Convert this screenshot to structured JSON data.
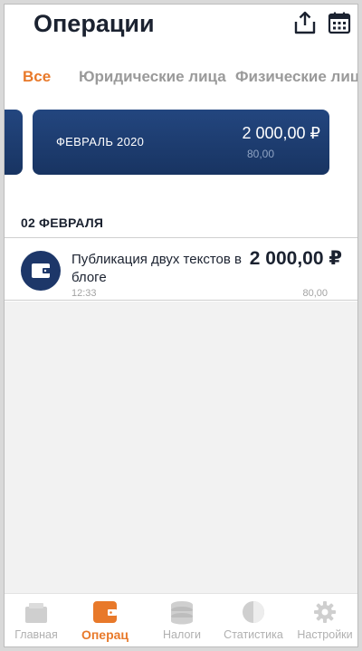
{
  "header": {
    "title": "Операции",
    "icons": [
      "share-icon",
      "calendar-icon"
    ]
  },
  "tabs": [
    {
      "label": "Все",
      "active": true
    },
    {
      "label": "Юридические лица",
      "active": false
    },
    {
      "label": "Физические лица",
      "active": false
    }
  ],
  "summary_card": {
    "month": "ФЕВРАЛЬ 2020",
    "amount": "2 000,00 ₽",
    "tax": "80,00"
  },
  "day_group": {
    "date": "02 ФЕВРАЛЯ",
    "operations": [
      {
        "title": "Публикация двух текстов в блоге",
        "amount": "2 000,00 ₽",
        "time": "12:33",
        "tax": "80,00",
        "icon": "wallet-icon"
      }
    ]
  },
  "bottom_nav": [
    {
      "label": "Главная",
      "icon": "home-icon",
      "active": false
    },
    {
      "label": "Операц",
      "icon": "wallet-icon",
      "active": true
    },
    {
      "label": "Налоги",
      "icon": "coins-icon",
      "active": false
    },
    {
      "label": "Статистика",
      "icon": "pie-chart-icon",
      "active": false
    },
    {
      "label": "Настройки",
      "icon": "gear-icon",
      "active": false
    }
  ],
  "colors": {
    "accent": "#e8792a",
    "card_blue": "#1d3769",
    "text_dark": "#1b2230",
    "text_muted": "#a3a3a3"
  }
}
